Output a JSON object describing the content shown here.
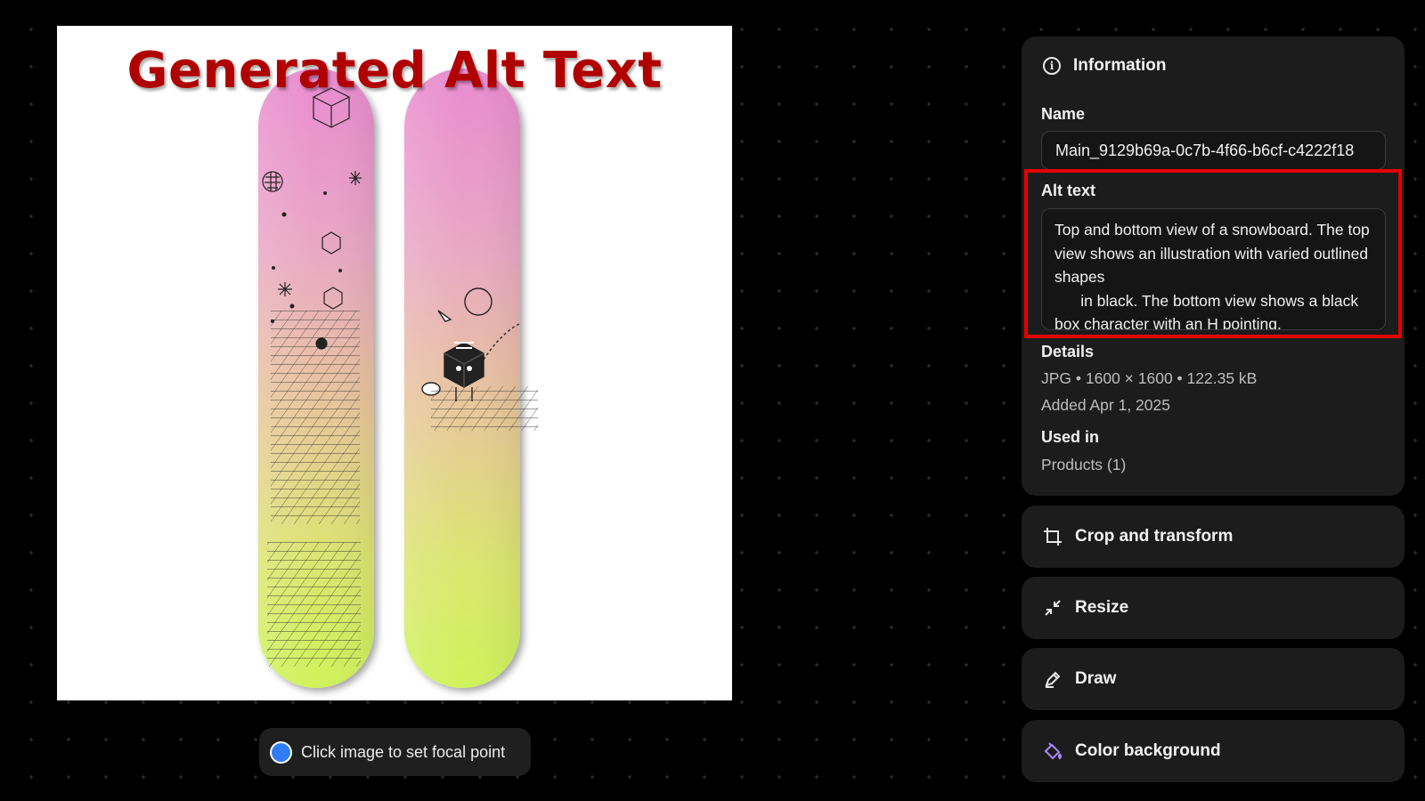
{
  "canvas": {
    "overlay_caption": "Generated Alt Text",
    "board_colors": {
      "top": "#e87fcf",
      "bottom": "#d4f25e"
    }
  },
  "focal": {
    "label": "Click image to set focal point",
    "dot_color": "#2f7cf6"
  },
  "info": {
    "title": "Information",
    "icon": "info-icon",
    "name_label": "Name",
    "name_value": "Main_9129b69a-0c7b-4f66-b6cf-c4222f18",
    "alt_label": "Alt text",
    "alt_value": "Top and bottom view of a snowboard. The top view shows an illustration with varied outlined shapes\n      in black. The bottom view shows a black box character with an H pointing.",
    "details_label": "Details",
    "details_line": "JPG • 1600 × 1600 • 122.35 kB",
    "added_line": "Added Apr 1, 2025",
    "used_label": "Used in",
    "used_line": "Products (1)"
  },
  "tools": [
    {
      "label": "Crop and transform",
      "icon": "crop-icon"
    },
    {
      "label": "Resize",
      "icon": "resize-icon"
    },
    {
      "label": "Draw",
      "icon": "draw-icon"
    },
    {
      "label": "Color background",
      "icon": "color-background-icon"
    }
  ],
  "colors": {
    "highlight": "#e60000",
    "panel": "#1c1c1c",
    "accent_purple": "#a78bfa"
  }
}
